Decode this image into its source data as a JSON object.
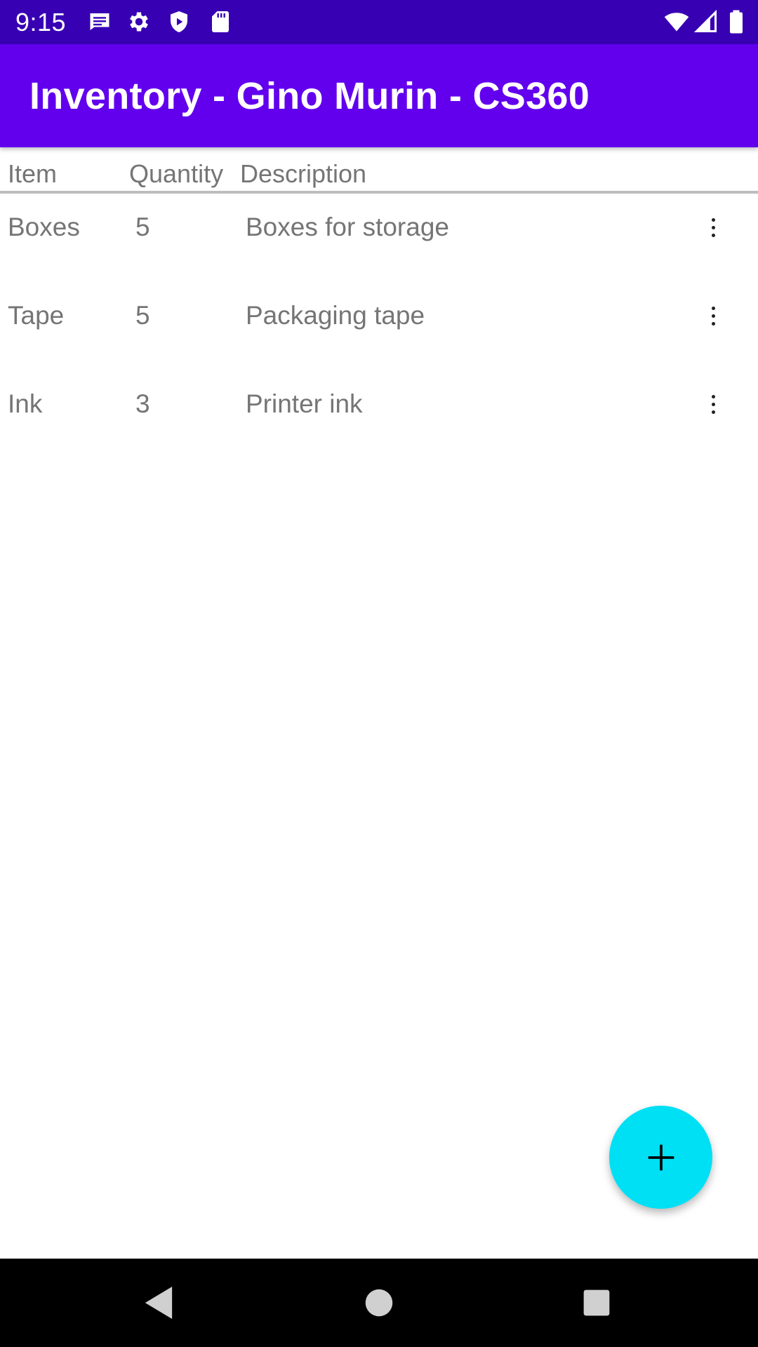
{
  "status_bar": {
    "time": "9:15",
    "left_icons": [
      "message-icon",
      "gear-icon",
      "shield-icon",
      "sd-card-icon"
    ],
    "right_icons": [
      "wifi-icon",
      "cell-signal-icon",
      "battery-icon"
    ]
  },
  "app_bar": {
    "title": "Inventory - Gino Murin - CS360",
    "color": "#6200ee",
    "status_color": "#3700b3"
  },
  "table": {
    "columns": [
      "Item",
      "Quantity",
      "Description"
    ],
    "rows": [
      {
        "item": "Boxes",
        "quantity": "5",
        "description": "Boxes for storage"
      },
      {
        "item": "Tape",
        "quantity": "5",
        "description": "Packaging tape"
      },
      {
        "item": "Ink",
        "quantity": "3",
        "description": "Printer ink"
      }
    ],
    "row_menu_icon": "more-vertical-icon"
  },
  "fab": {
    "icon": "plus-icon",
    "color": "#00e0f5"
  },
  "nav_bar": {
    "buttons": [
      "back-icon",
      "home-icon",
      "recents-icon"
    ]
  }
}
